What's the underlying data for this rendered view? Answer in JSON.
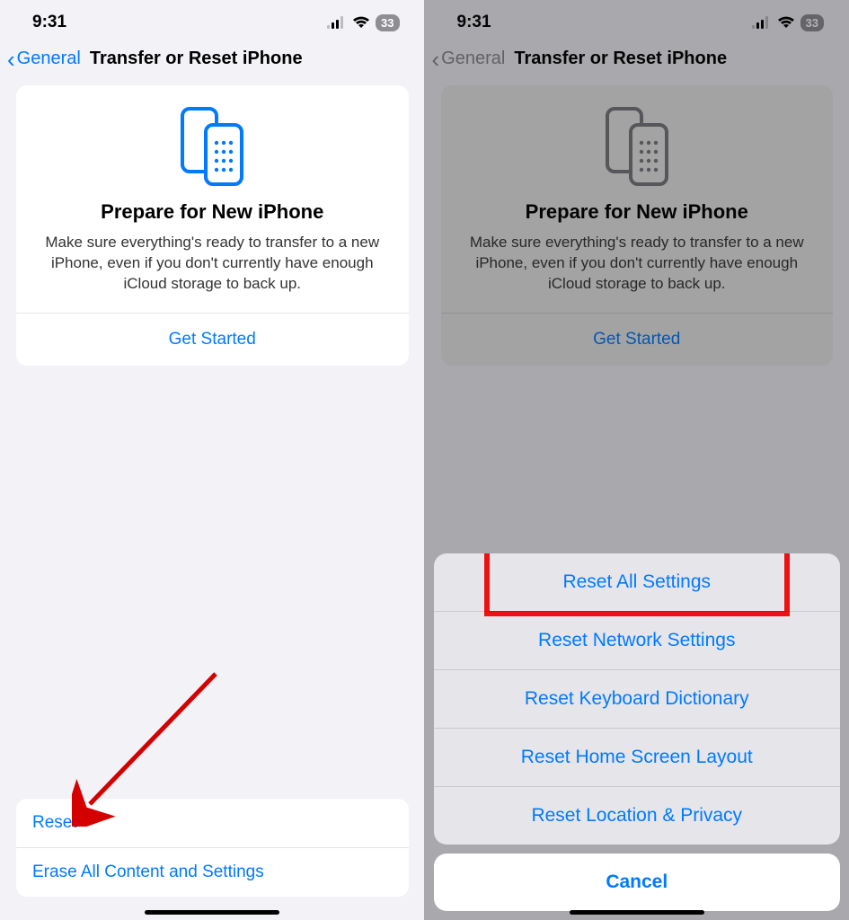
{
  "status": {
    "time": "9:31",
    "battery": "33"
  },
  "nav": {
    "back": "General",
    "title": "Transfer or Reset iPhone"
  },
  "card": {
    "title": "Prepare for New iPhone",
    "desc": "Make sure everything's ready to transfer to a new iPhone, even if you don't currently have enough iCloud storage to back up.",
    "cta": "Get Started"
  },
  "left": {
    "rows": {
      "reset": "Reset",
      "erase": "Erase All Content and Settings"
    }
  },
  "sheet": {
    "opts": {
      "all": "Reset All Settings",
      "network": "Reset Network Settings",
      "keyboard": "Reset Keyboard Dictionary",
      "home": "Reset Home Screen Layout",
      "location": "Reset Location & Privacy"
    },
    "cancel": "Cancel"
  },
  "annotations": {
    "arrow_target": "reset-row",
    "highlight_target": "reset-all-settings"
  }
}
